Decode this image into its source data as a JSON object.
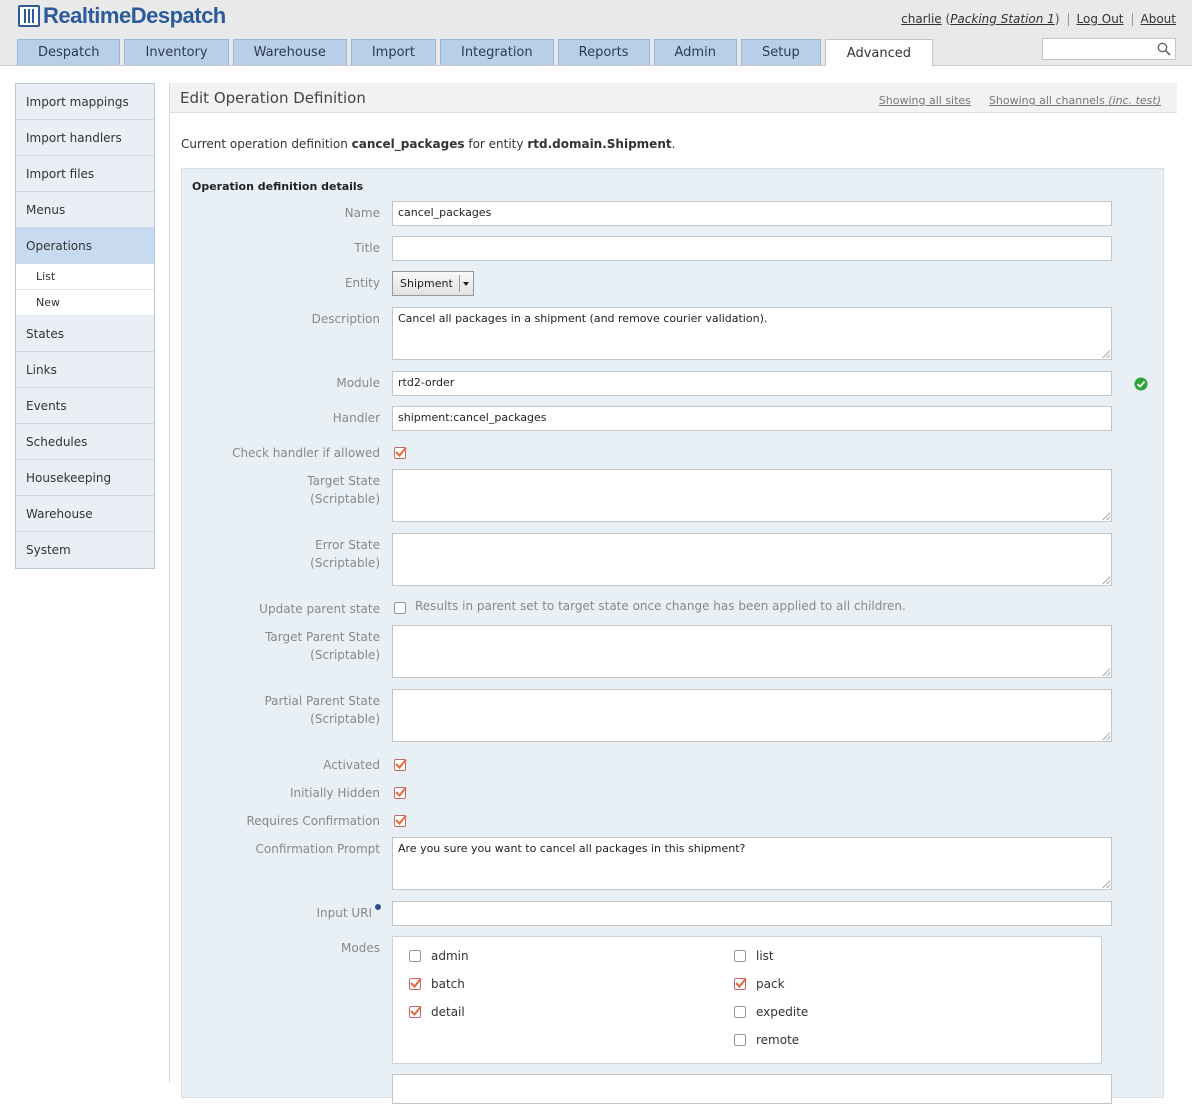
{
  "header": {
    "logo_text": "RealtimeDespatch",
    "user": "charlie",
    "station_open": "(",
    "station": "Packing Station 1",
    "station_close": ")",
    "logout": "Log Out",
    "about": "About"
  },
  "tabs": [
    {
      "label": "Despatch",
      "active": false
    },
    {
      "label": "Inventory",
      "active": false
    },
    {
      "label": "Warehouse",
      "active": false
    },
    {
      "label": "Import",
      "active": false
    },
    {
      "label": "Integration",
      "active": false
    },
    {
      "label": "Reports",
      "active": false
    },
    {
      "label": "Admin",
      "active": false
    },
    {
      "label": "Setup",
      "active": false
    },
    {
      "label": "Advanced",
      "active": true
    }
  ],
  "search": {
    "value": ""
  },
  "sidebar": {
    "items": [
      {
        "label": "Import mappings"
      },
      {
        "label": "Import handlers"
      },
      {
        "label": "Import files"
      },
      {
        "label": "Menus"
      },
      {
        "label": "Operations"
      },
      {
        "label": "List"
      },
      {
        "label": "New"
      },
      {
        "label": "States"
      },
      {
        "label": "Links"
      },
      {
        "label": "Events"
      },
      {
        "label": "Schedules"
      },
      {
        "label": "Housekeeping"
      },
      {
        "label": "Warehouse"
      },
      {
        "label": "System"
      }
    ]
  },
  "main": {
    "title": "Edit Operation Definition",
    "filter_sites": "Showing all sites",
    "filter_channels": "Showing all channels",
    "filter_channels_note": "(inc. test)",
    "current_prefix": "Current operation definition",
    "current_name": "cancel_packages",
    "current_mid": "for entity",
    "current_entity": "rtd.domain.Shipment",
    "current_suffix": "."
  },
  "form": {
    "section_title": "Operation definition details",
    "name_label": "Name",
    "name_value": "cancel_packages",
    "title_label": "Title",
    "title_value": "",
    "entity_label": "Entity",
    "entity_value": "Shipment",
    "description_label": "Description",
    "description_value": "Cancel all packages in a shipment (and remove courier validation).",
    "module_label": "Module",
    "module_value": "rtd2-order",
    "handler_label": "Handler",
    "handler_value": "shipment:cancel_packages",
    "check_handler_label": "Check handler if allowed",
    "check_handler": true,
    "target_state_label": "Target State",
    "target_state_label2": "(Scriptable)",
    "error_state_label": "Error State",
    "error_state_label2": "(Scriptable)",
    "update_parent_label": "Update parent state",
    "update_parent": false,
    "update_parent_hint": "Results in parent set to target state once change has been applied to all children.",
    "target_parent_label": "Target Parent State",
    "target_parent_label2": "(Scriptable)",
    "partial_parent_label": "Partial Parent State",
    "partial_parent_label2": "(Scriptable)",
    "activated_label": "Activated",
    "activated": true,
    "hidden_label": "Initially Hidden",
    "hidden": true,
    "confirm_label": "Requires Confirmation",
    "confirm": true,
    "prompt_label": "Confirmation Prompt",
    "prompt_value": "Are you sure you want to cancel all packages in this shipment?",
    "input_uri_label": "Input URI",
    "input_uri_value": "",
    "modes_label": "Modes",
    "modes": [
      {
        "label": "admin",
        "checked": false
      },
      {
        "label": "batch",
        "checked": true
      },
      {
        "label": "detail",
        "checked": true
      },
      {
        "label": "list",
        "checked": false
      },
      {
        "label": "pack",
        "checked": true
      },
      {
        "label": "expedite",
        "checked": false
      },
      {
        "label": "remote",
        "checked": false
      }
    ]
  },
  "colors": {
    "accent": "#2c5a9a",
    "tab": "#b9cfe8",
    "panel": "#e8f0f6",
    "check": "#e06a3c"
  }
}
